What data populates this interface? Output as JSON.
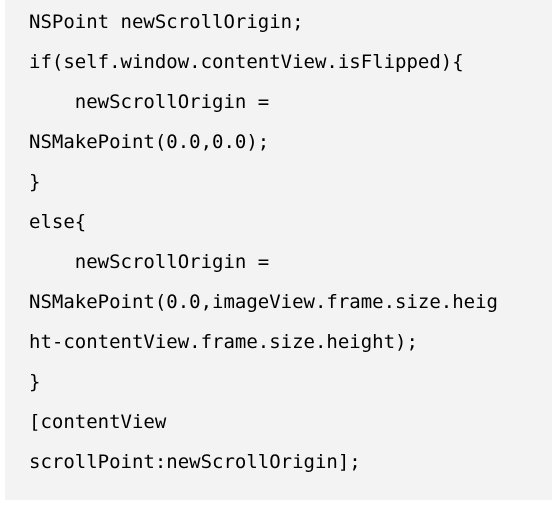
{
  "code": {
    "lines": [
      "NSPoint newScrollOrigin;",
      "if(self.window.contentView.isFlipped){",
      "    newScrollOrigin =",
      "NSMakePoint(0.0,0.0);",
      "}",
      "else{",
      "    newScrollOrigin =",
      "NSMakePoint(0.0,imageView.frame.size.heig",
      "ht-contentView.frame.size.height);",
      "}",
      "[contentView",
      "scrollPoint:newScrollOrigin];"
    ]
  }
}
